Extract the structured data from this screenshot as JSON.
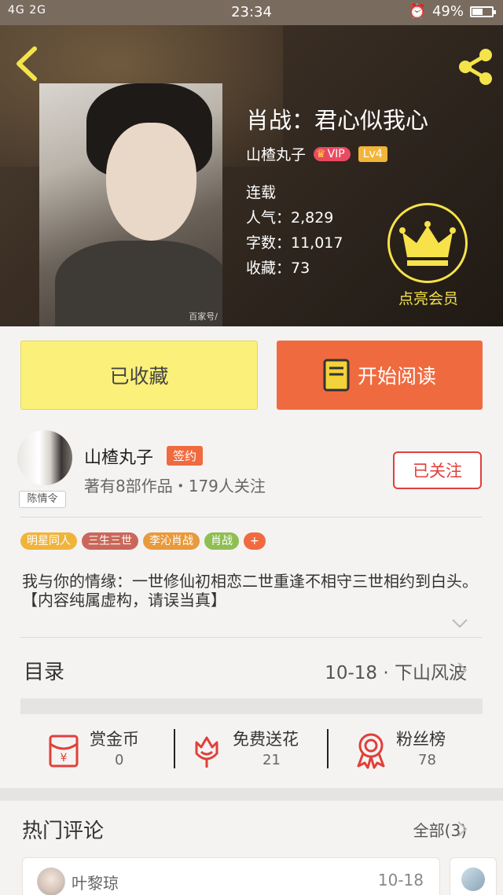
{
  "status_bar": {
    "signal": "4G 2G",
    "time": "23:34",
    "battery": "49%",
    "battery_level": 0.49
  },
  "book": {
    "title": "肖战：君心似我心",
    "author": "山楂丸子",
    "vip": "VIP",
    "level": "Lv4",
    "status": "连载",
    "popularity": "人气：2,829",
    "word_count": "字数：11,017",
    "favorites": "收藏：73",
    "member_label": "点亮会员",
    "cover_watermark": "百家号/"
  },
  "actions": {
    "collected": "已收藏",
    "start_reading": "开始阅读"
  },
  "author": {
    "name": "山楂丸子",
    "sign": "签约",
    "stats": "著有8部作品・179人关注",
    "follow": "已关注",
    "avatar_tag": "陈情令"
  },
  "tags": [
    {
      "label": "明星同人",
      "color": "#f0b43c"
    },
    {
      "label": "三生三世",
      "color": "#c9685a"
    },
    {
      "label": "李沁肖战",
      "color": "#e89a3c"
    },
    {
      "label": "肖战",
      "color": "#8fbf54"
    },
    {
      "label": "+",
      "color": "#ef6b3f"
    }
  ],
  "description": "我与你的情缘：一世修仙初相恋二世重逢不相守三世相约到白头。【内容纯属虚构，请误当真】",
  "catalog": {
    "label": "目录",
    "latest": "10-18 · 下山风波"
  },
  "stats": [
    {
      "label": "赏金币",
      "value": "0",
      "icon": "red-envelope-icon"
    },
    {
      "label": "免费送花",
      "value": "21",
      "icon": "flower-icon"
    },
    {
      "label": "粉丝榜",
      "value": "78",
      "icon": "medal-icon"
    }
  ],
  "comments": {
    "label": "热门评论",
    "all": "全部(3)",
    "first": {
      "user": "叶黎琼",
      "date": "10-18"
    }
  }
}
